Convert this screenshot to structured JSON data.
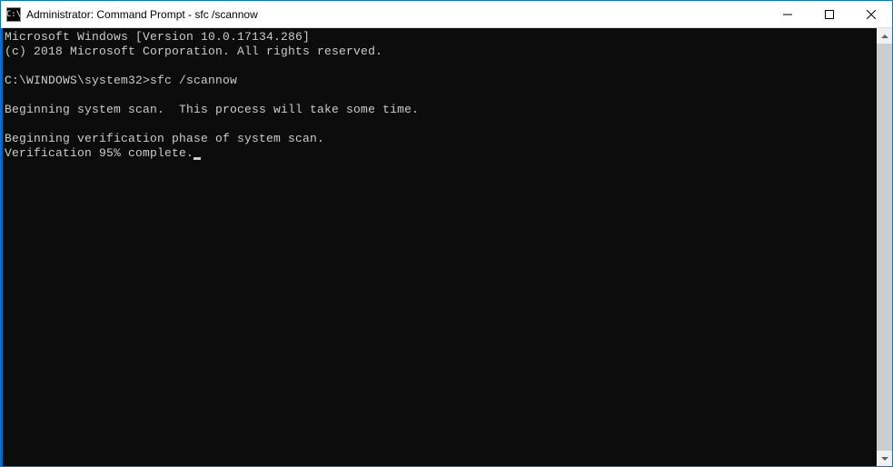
{
  "window": {
    "title": "Administrator: Command Prompt - sfc  /scannow",
    "icon_label": "C:\\"
  },
  "terminal": {
    "line1": "Microsoft Windows [Version 10.0.17134.286]",
    "line2": "(c) 2018 Microsoft Corporation. All rights reserved.",
    "blank1": "",
    "prompt": "C:\\WINDOWS\\system32>",
    "command": "sfc /scannow",
    "blank2": "",
    "scan1": "Beginning system scan.  This process will take some time.",
    "blank3": "",
    "scan2": "Beginning verification phase of system scan.",
    "progress": "Verification 95% complete."
  }
}
